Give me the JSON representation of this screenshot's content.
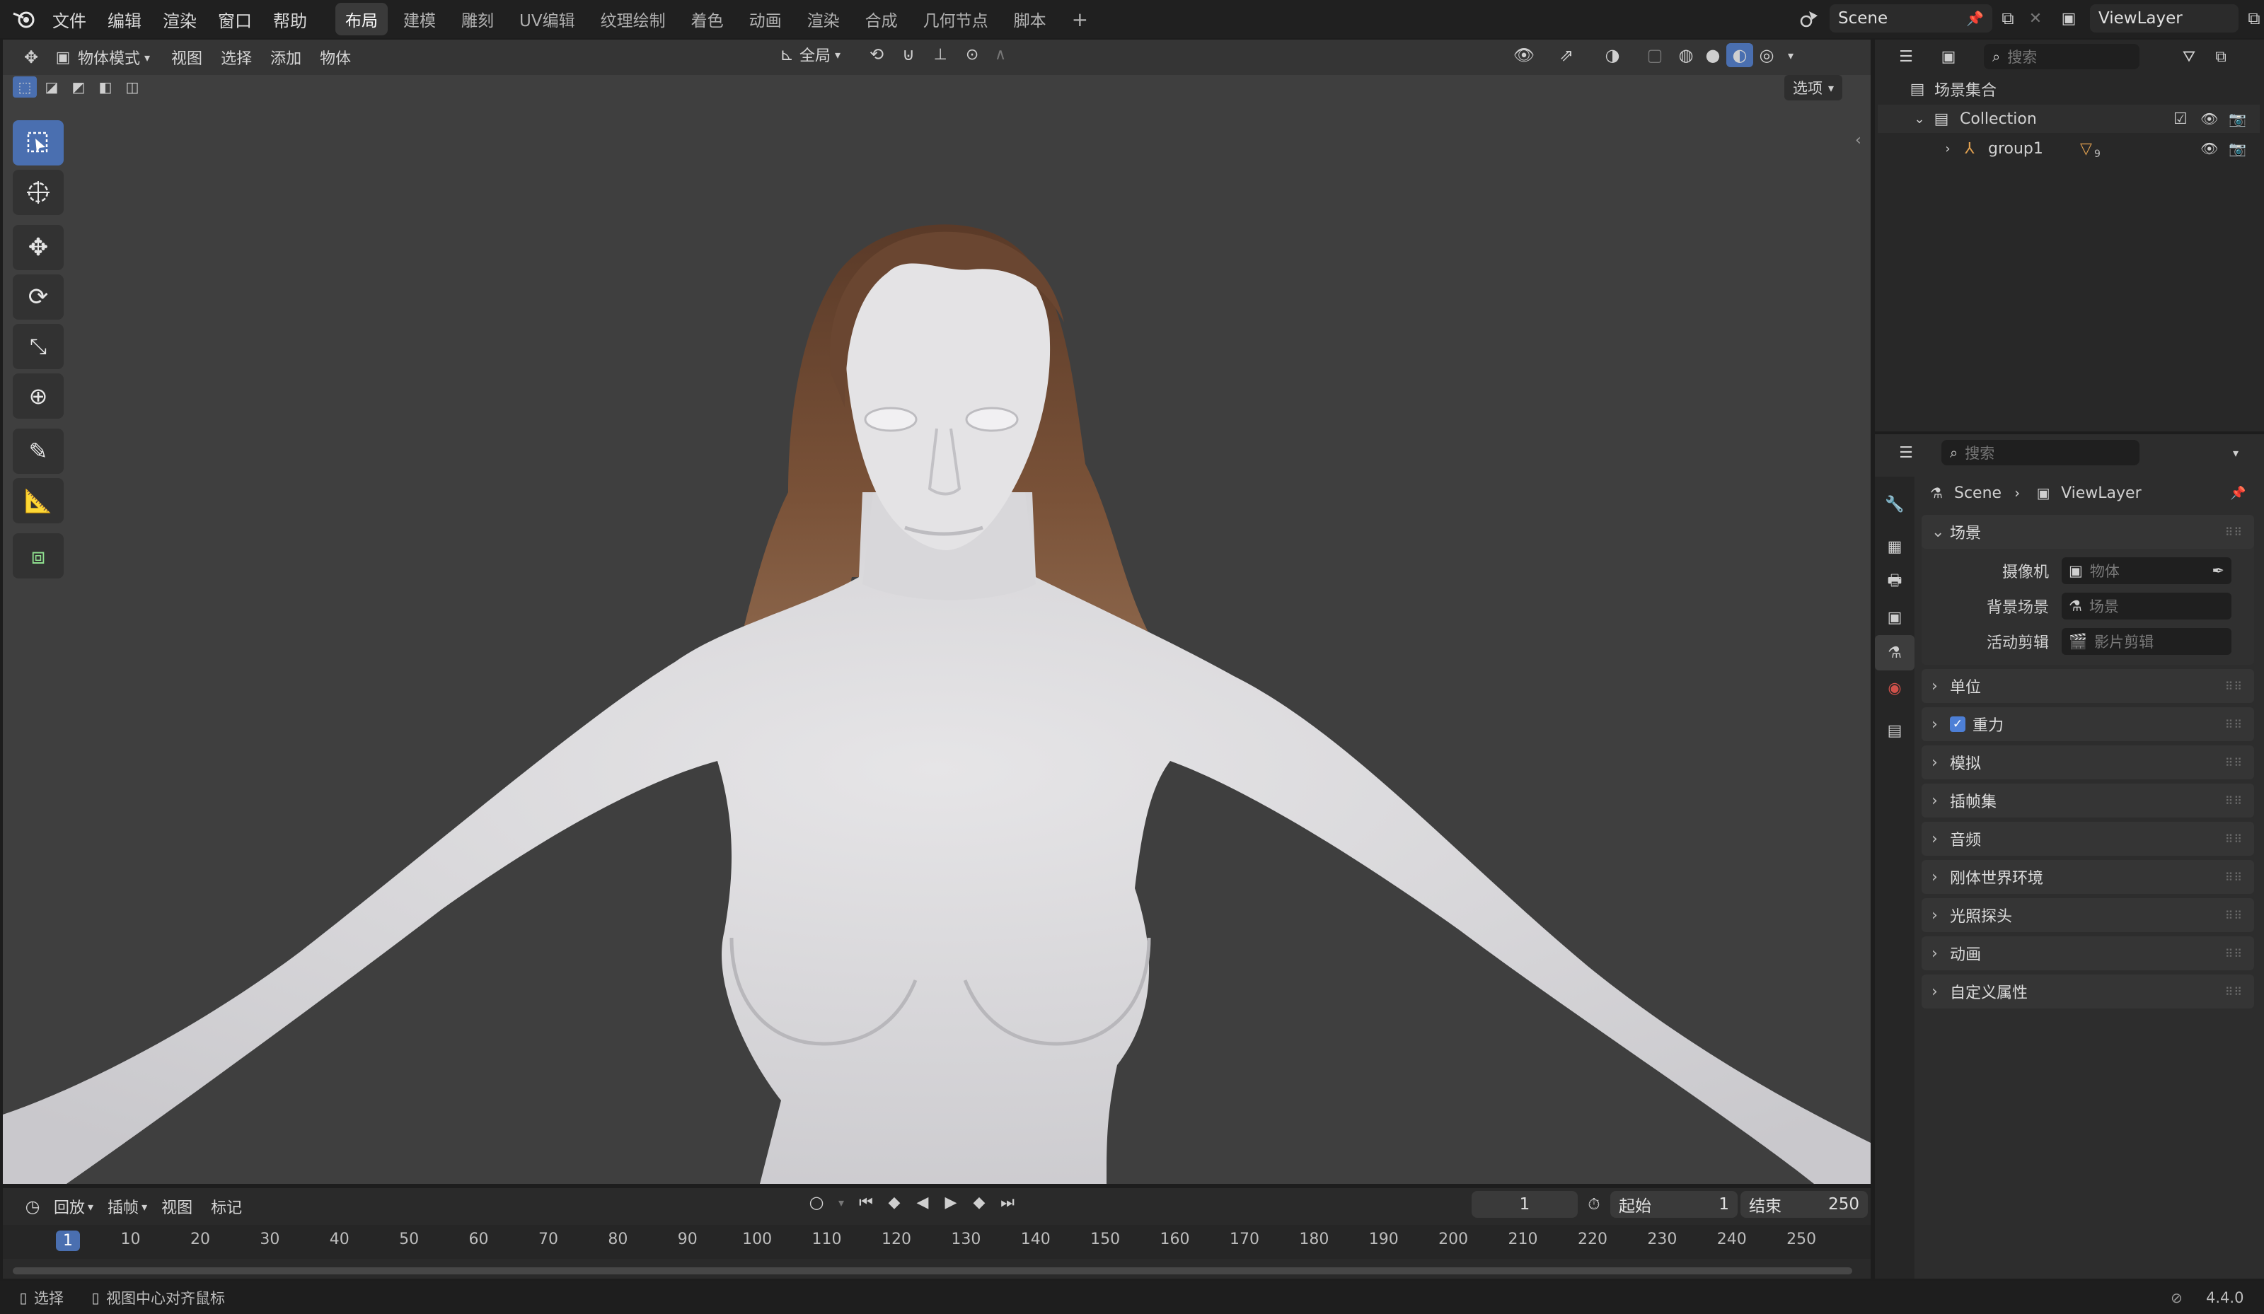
{
  "top_menu": {
    "items": [
      "文件",
      "编辑",
      "渲染",
      "窗口",
      "帮助"
    ],
    "workspace_tabs": [
      "布局",
      "建模",
      "雕刻",
      "UV编辑",
      "纹理绘制",
      "着色",
      "动画",
      "渲染",
      "合成",
      "几何节点",
      "脚本"
    ],
    "active_tab": "布局",
    "add_tab": "+",
    "scene_name": "Scene",
    "view_layer": "ViewLayer"
  },
  "viewport": {
    "mode": "物体模式",
    "menus": [
      "视图",
      "选择",
      "添加",
      "物体"
    ],
    "transform_orientation": "全局",
    "options_label": "选项"
  },
  "outliner": {
    "search_placeholder": "搜索",
    "root": "场景集合",
    "collection": "Collection",
    "object": "group1",
    "object_badge": "9"
  },
  "properties": {
    "search_placeholder": "搜索",
    "breadcrumb": [
      "Scene",
      "ViewLayer"
    ],
    "scene_section": "场景",
    "fields": [
      {
        "label": "摄像机",
        "placeholder": "物体"
      },
      {
        "label": "背景场景",
        "placeholder": "场景"
      },
      {
        "label": "活动剪辑",
        "placeholder": "影片剪辑"
      }
    ],
    "sections": [
      "单位",
      "重力",
      "模拟",
      "插帧集",
      "音频",
      "刚体世界环境",
      "光照探头",
      "动画",
      "自定义属性"
    ],
    "checked_section": "重力"
  },
  "timeline": {
    "menus": [
      "回放",
      "插帧",
      "视图",
      "标记"
    ],
    "current_frame": "1",
    "start_label": "起始",
    "start": "1",
    "end_label": "结束",
    "end": "250",
    "ticks": [
      "1",
      "10",
      "20",
      "30",
      "40",
      "50",
      "60",
      "70",
      "80",
      "90",
      "100",
      "110",
      "120",
      "130",
      "140",
      "150",
      "160",
      "170",
      "180",
      "190",
      "200",
      "210",
      "220",
      "230",
      "240",
      "250"
    ]
  },
  "statusbar": {
    "select": "选择",
    "center_view": "视图中心对齐鼠标",
    "version": "4.4.0"
  },
  "colors": {
    "accent": "#4a6fb0",
    "background": "#1d1d1d",
    "viewport": "#3f3f3f",
    "hair": "#7a5238",
    "skin": "#e0dfe1"
  }
}
